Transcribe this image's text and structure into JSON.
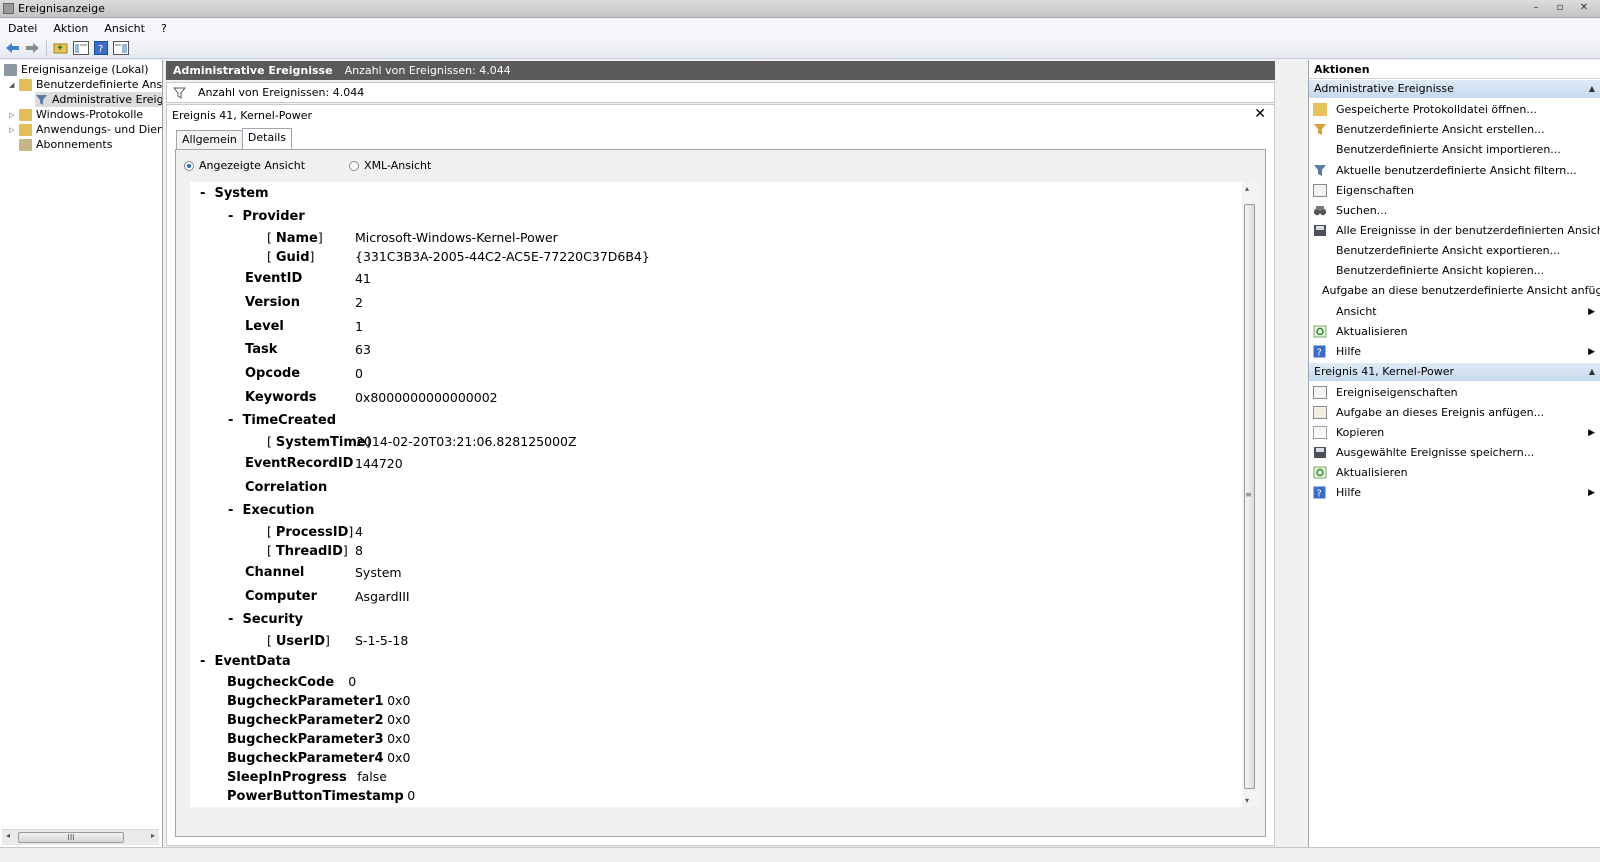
{
  "window": {
    "title": "Ereignisanzeige",
    "controls": [
      "–",
      "▫",
      "✕"
    ]
  },
  "menu": [
    "Datei",
    "Aktion",
    "Ansicht",
    "?"
  ],
  "tree": {
    "items": [
      {
        "label": "Ereignisanzeige (Lokal)",
        "icon": "computer-icon"
      },
      {
        "label": "Benutzerdefinierte Ansichten",
        "icon": "folder-icon"
      },
      {
        "label": "Administrative Ereignisse",
        "icon": "filter-icon"
      },
      {
        "label": "Windows-Protokolle",
        "icon": "folder-icon"
      },
      {
        "label": "Anwendungs- und Dienstprotokolle",
        "icon": "folder-icon"
      },
      {
        "label": "Abonnements",
        "icon": "subscription-icon"
      }
    ],
    "scroll_grip": "III"
  },
  "middle": {
    "header_title": "Administrative Ereignisse",
    "header_count": "Anzahl von Ereignissen: 4.044",
    "filter_text": "Anzahl von Ereignissen: 4.044",
    "event_title": "Ereignis 41, Kernel-Power",
    "close": "✕",
    "tabs": [
      "Allgemein",
      "Details"
    ],
    "radio_friendly": "Angezeigte Ansicht",
    "radio_xml": "XML-Ansicht",
    "scroll_grip": "≡"
  },
  "detail": {
    "system": "System",
    "provider": "Provider",
    "name_key": "Name",
    "name_val": "Microsoft-Windows-Kernel-Power",
    "guid_key": "Guid",
    "guid_val": "{331C3B3A-2005-44C2-AC5E-77220C37D6B4}",
    "eventid_key": "EventID",
    "eventid_val": "41",
    "version_key": "Version",
    "version_val": "2",
    "level_key": "Level",
    "level_val": "1",
    "task_key": "Task",
    "task_val": "63",
    "opcode_key": "Opcode",
    "opcode_val": "0",
    "keywords_key": "Keywords",
    "keywords_val": "0x8000000000000002",
    "timecreated": "TimeCreated",
    "systemtime_key": "SystemTime",
    "systemtime_val": "2014-02-20T03:21:06.828125000Z",
    "recordid_key": "EventRecordID",
    "recordid_val": "144720",
    "correlation": "Correlation",
    "execution": "Execution",
    "processid_key": "ProcessID",
    "processid_val": "4",
    "threadid_key": "ThreadID",
    "threadid_val": "8",
    "channel_key": "Channel",
    "channel_val": "System",
    "computer_key": "Computer",
    "computer_val": "AsgardIII",
    "security": "Security",
    "userid_key": "UserID",
    "userid_val": "S-1-5-18",
    "eventdata": "EventData",
    "bugcheck_key": "BugcheckCode",
    "bugcheck_val": "0",
    "p1_key": "BugcheckParameter1",
    "p1_val": "0x0",
    "p2_key": "BugcheckParameter2",
    "p2_val": "0x0",
    "p3_key": "BugcheckParameter3",
    "p3_val": "0x0",
    "p4_key": "BugcheckParameter4",
    "p4_val": "0x0",
    "sleep_key": "SleepInProgress",
    "sleep_val": "false",
    "pbt_key": "PowerButtonTimestamp",
    "pbt_val": "0"
  },
  "actions": {
    "title": "Aktionen",
    "section1": "Administrative Ereignisse",
    "items1": [
      "Gespeicherte Protokolldatei öffnen...",
      "Benutzerdefinierte Ansicht erstellen...",
      "Benutzerdefinierte Ansicht importieren...",
      "Aktuelle benutzerdefinierte Ansicht filtern...",
      "Eigenschaften",
      "Suchen...",
      "Alle Ereignisse in der benutzerdefinierten Ansicht speic...",
      "Benutzerdefinierte Ansicht exportieren...",
      "Benutzerdefinierte Ansicht kopieren...",
      "Aufgabe an diese benutzerdefinierte Ansicht anfügen...",
      "Ansicht",
      "Aktualisieren",
      "Hilfe"
    ],
    "section2": "Ereignis 41, Kernel-Power",
    "items2": [
      "Ereigniseigenschaften",
      "Aufgabe an dieses Ereignis anfügen...",
      "Kopieren",
      "Ausgewählte Ereignisse speichern...",
      "Aktualisieren",
      "Hilfe"
    ]
  },
  "colors": {
    "header_bg": "#5a5a5a",
    "section_bg": "#c6d8ef",
    "accent": "#2a6cc4"
  }
}
